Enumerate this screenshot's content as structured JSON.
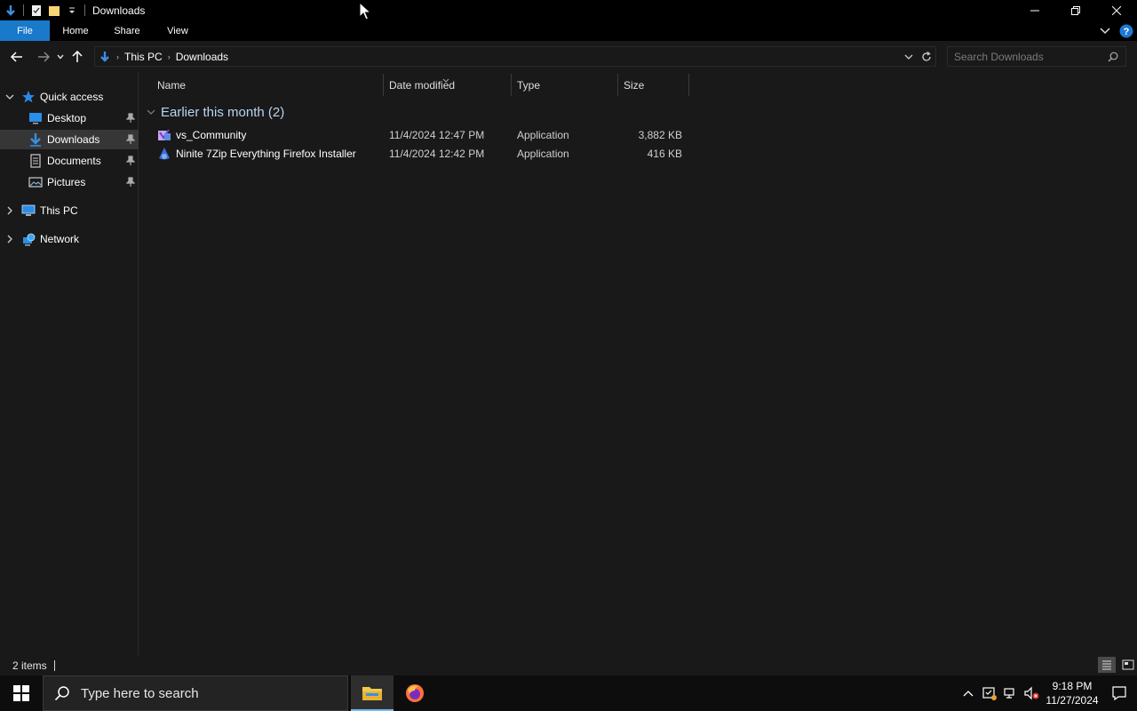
{
  "window": {
    "title": "Downloads",
    "controls": [
      "minimize-icon",
      "restore-icon",
      "close-icon"
    ]
  },
  "ribbon": {
    "tabs": [
      {
        "label": "File"
      },
      {
        "label": "Home"
      },
      {
        "label": "Share"
      },
      {
        "label": "View"
      }
    ]
  },
  "address": {
    "crumbs": [
      "This PC",
      "Downloads"
    ],
    "search_placeholder": "Search Downloads"
  },
  "sidebar": {
    "items": [
      {
        "label": "Quick access",
        "icon": "star-icon"
      },
      {
        "label": "Desktop",
        "icon": "desktop-folder-icon",
        "pinned": true
      },
      {
        "label": "Downloads",
        "icon": "download-folder-icon",
        "pinned": true,
        "selected": true
      },
      {
        "label": "Documents",
        "icon": "documents-folder-icon",
        "pinned": true
      },
      {
        "label": "Pictures",
        "icon": "pictures-folder-icon",
        "pinned": true
      },
      {
        "label": "This PC",
        "icon": "computer-icon"
      },
      {
        "label": "Network",
        "icon": "network-icon"
      }
    ]
  },
  "columns": {
    "name": "Name",
    "date": "Date modified",
    "type": "Type",
    "size": "Size"
  },
  "group": {
    "label": "Earlier this month (2)"
  },
  "files": [
    {
      "name": "vs_Community",
      "date": "11/4/2024 12:47 PM",
      "type": "Application",
      "size": "3,882 KB",
      "icon": "visual-studio-icon"
    },
    {
      "name": "Ninite 7Zip Everything Firefox Installer",
      "date": "11/4/2024 12:42 PM",
      "type": "Application",
      "size": "416 KB",
      "icon": "ninite-icon"
    }
  ],
  "status": {
    "items": "2 items"
  },
  "taskbar": {
    "search_placeholder": "Type here to search",
    "apps": [
      "file-explorer-icon",
      "firefox-icon"
    ],
    "time": "9:18 PM",
    "date": "11/27/2024"
  },
  "colors": {
    "accent": "#1979ca",
    "background": "#191919",
    "selected": "#363636",
    "group_text": "#b6d6f2"
  }
}
